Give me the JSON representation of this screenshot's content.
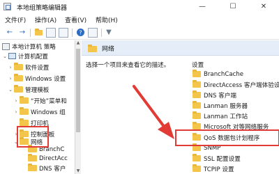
{
  "window": {
    "title": "本地组策略编辑器",
    "min_glyph": "—",
    "max_glyph": "☐",
    "close_glyph": "✕"
  },
  "menu": {
    "items": [
      "文件(F)",
      "操作(A)",
      "查看(V)",
      "帮助(H)"
    ]
  },
  "toolbar": {
    "back": "←",
    "forward": "→",
    "filter": "▼"
  },
  "tree": {
    "items": [
      {
        "label": "本地计算机 策略",
        "chev": "",
        "icon": "policy"
      },
      {
        "label": "计算机配置",
        "chev": "⌄",
        "icon": "computer"
      },
      {
        "label": "软件设置",
        "chev": "›",
        "icon": "folder"
      },
      {
        "label": "Windows 设置",
        "chev": "›",
        "icon": "folder"
      },
      {
        "label": "管理模板",
        "chev": "⌄",
        "icon": "folder"
      },
      {
        "label": "“开始”菜单和",
        "chev": "›",
        "icon": "folder"
      },
      {
        "label": "Windows 组",
        "chev": "›",
        "icon": "folder"
      },
      {
        "label": "打印机",
        "chev": "",
        "icon": "folder"
      },
      {
        "label": "控制面板",
        "chev": "›",
        "icon": "folder"
      },
      {
        "label": "网络",
        "chev": "⌄",
        "icon": "folder"
      },
      {
        "label": "BranchC",
        "chev": "",
        "icon": "folder"
      },
      {
        "label": "DirectAcc",
        "chev": "",
        "icon": "folder"
      },
      {
        "label": "DNS 客户",
        "chev": "",
        "icon": "folder"
      }
    ]
  },
  "main": {
    "header_title": "网络",
    "description": "选择一个项目来查看它的描述。",
    "settings_label": "设置",
    "settings": [
      "BranchCache",
      "DirectAccess 客户端体验设置",
      "DNS 客户端",
      "Lanman 服务器",
      "Lanman 工作站",
      "Microsoft 对等网络服务",
      "QoS 数据包计划程序",
      "SNMP",
      "SSL 配置设置",
      "TCPIP 设置"
    ]
  },
  "colors": {
    "highlight_red": "#e23a35",
    "header_blue": "#e5eef8",
    "folder_yellow": "#f3c64b"
  }
}
